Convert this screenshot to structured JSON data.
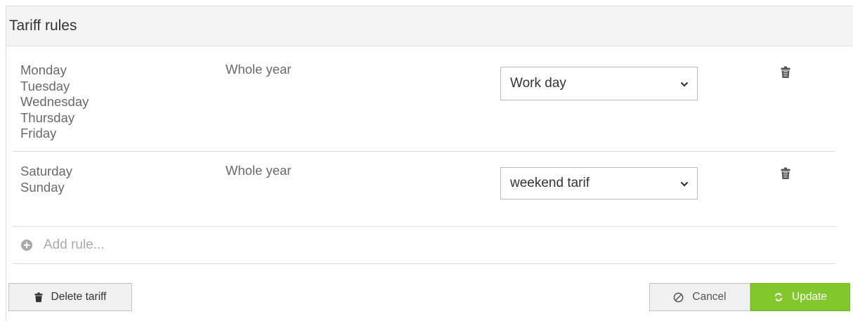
{
  "panel": {
    "title": "Tariff rules"
  },
  "rules": [
    {
      "days": [
        "Monday",
        "Tuesday",
        "Wednesday",
        "Thursday",
        "Friday"
      ],
      "period": "Whole year",
      "tariff": "Work day"
    },
    {
      "days": [
        "Saturday",
        "Sunday"
      ],
      "period": "Whole year",
      "tariff": "weekend tarif"
    }
  ],
  "add_rule_label": "Add rule...",
  "footer": {
    "delete_label": "Delete tariff",
    "cancel_label": "Cancel",
    "update_label": "Update"
  },
  "icons": {
    "trash": "trash-icon",
    "chevron": "chevron-down-icon",
    "plus": "plus-circle-icon",
    "cancel": "ban-icon",
    "update": "refresh-icon"
  },
  "colors": {
    "update_button": "#82c72b",
    "header_bg": "#f4f4f4"
  }
}
